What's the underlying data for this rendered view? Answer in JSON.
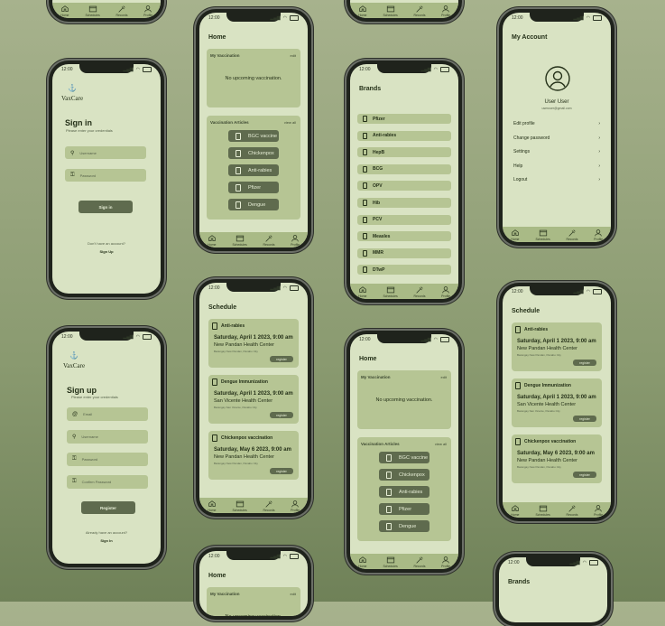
{
  "status_time": "12:00",
  "nav": [
    "Home",
    "Schedules",
    "Records",
    "Profile"
  ],
  "login": {
    "logo": "VaxCare",
    "title": "Sign in",
    "subtitle": "Please enter your credentials",
    "username_ph": "Username",
    "password_ph": "Password",
    "button": "Sign in",
    "noaccount": "Don't have an account?",
    "signup": "Sign Up"
  },
  "signup": {
    "logo": "VaxCare",
    "title": "Sign up",
    "subtitle": "Please enter your credentials",
    "email_ph": "Email",
    "username_ph": "Username",
    "password_ph": "Password",
    "confirm_ph": "Confirm Password",
    "button": "Register",
    "have": "Already have an account?",
    "signin": "Sign In"
  },
  "home": {
    "title": "Home",
    "my_vacc": "My Vaccination",
    "edit": "edit",
    "none": "No upcoming vaccination.",
    "articles": "Vaccination Articles",
    "viewall": "view all",
    "items": [
      "BGC vaccine",
      "Chickenpox",
      "Anti-rabies",
      "Pfizer",
      "Dengue"
    ]
  },
  "brands": {
    "title": "Brands",
    "items": [
      "Pfizer",
      "Anti-rabies",
      "HepB",
      "BCG",
      "OPV",
      "Hib",
      "PCV",
      "Measles",
      "MMR",
      "DTwP"
    ]
  },
  "account": {
    "title": "My Account",
    "name": "User User",
    "email": "useruser@gmail.com",
    "items": [
      "Edit profile",
      "Change password",
      "Settings",
      "Help",
      "Logout"
    ]
  },
  "schedule": {
    "title": "Schedule",
    "register": "register",
    "cards": [
      {
        "name": "Anti-rabies",
        "date": "Saturday, April 1 2023, 9:00 am",
        "place": "New Pandan Health Center",
        "addr": "Barangay New Pandan, Panabo City"
      },
      {
        "name": "Dengue Immunization",
        "date": "Saturday, April 1 2023, 9:00 am",
        "place": "San Vicente Health Center",
        "addr": "Barangay San Vicente, Panabo City"
      },
      {
        "name": "Chickenpox vaccination",
        "date": "Saturday, May 6 2023, 9:00 am",
        "place": "New Pandan Health Center",
        "addr": "Barangay New Pandan, Panabo City"
      }
    ]
  }
}
